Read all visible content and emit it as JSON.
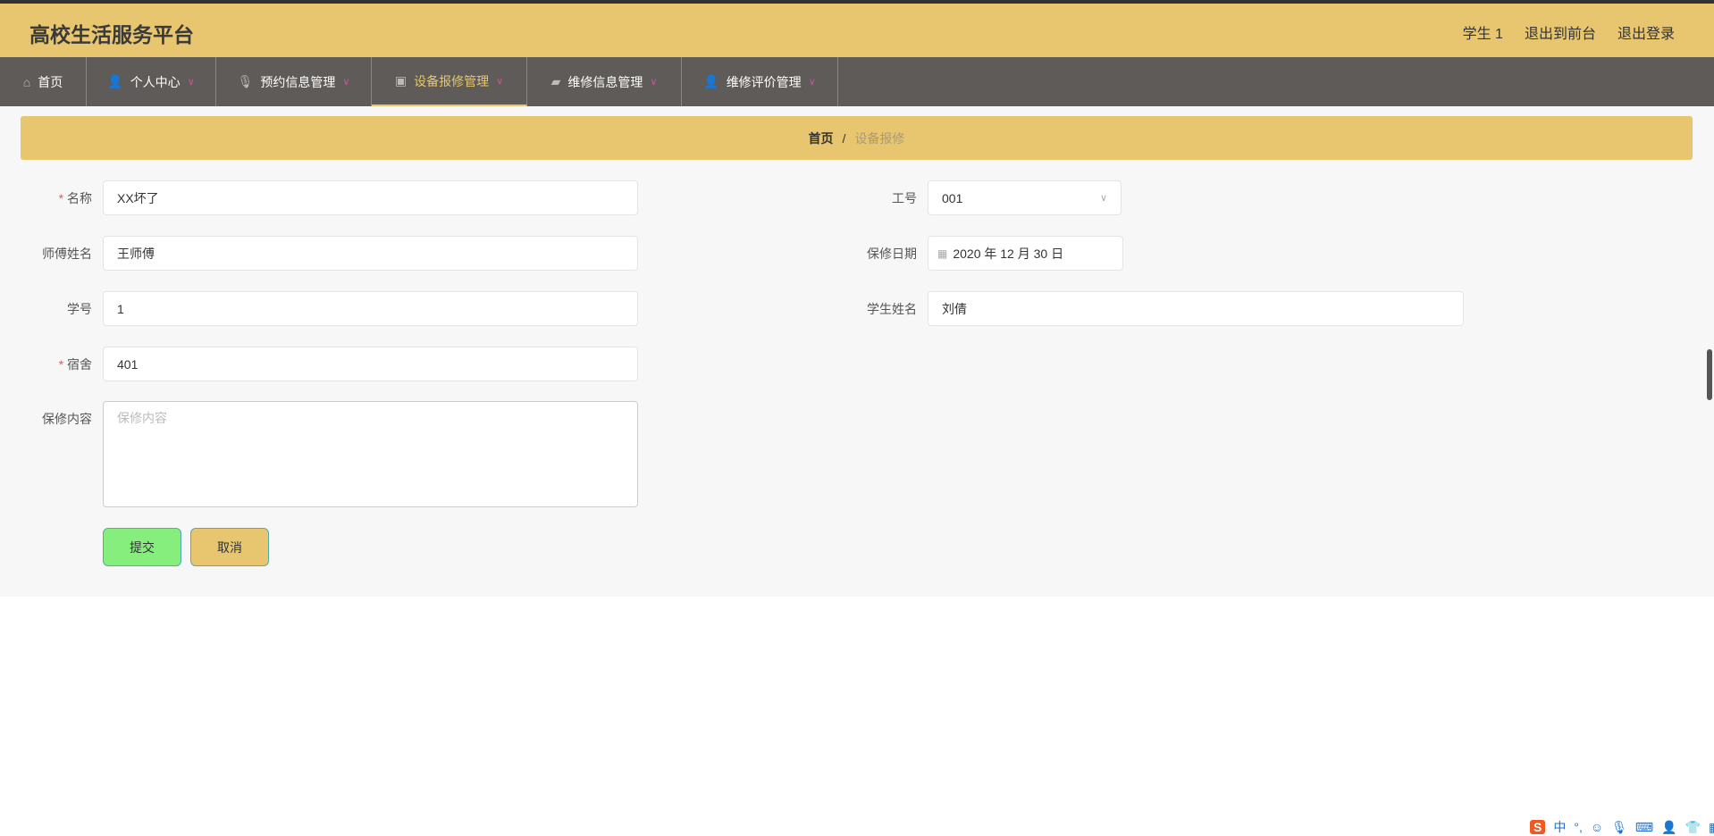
{
  "header": {
    "title": "高校生活服务平台",
    "links": [
      "学生 1",
      "退出到前台",
      "退出登录"
    ]
  },
  "nav": [
    {
      "label": "首页",
      "icon": "home-icon"
    },
    {
      "label": "个人中心",
      "icon": "user-icon"
    },
    {
      "label": "预约信息管理",
      "icon": "microphone-icon"
    },
    {
      "label": "设备报修管理",
      "icon": "clipboard-icon",
      "active": true
    },
    {
      "label": "维修信息管理",
      "icon": "wallet-icon"
    },
    {
      "label": "维修评价管理",
      "icon": "user-icon"
    }
  ],
  "breadcrumb": {
    "home": "首页",
    "sep": "/",
    "current": "设备报修"
  },
  "form": {
    "name": {
      "label": "名称",
      "value": "XX坏了"
    },
    "worker_id": {
      "label": "工号",
      "value": "001"
    },
    "master_name": {
      "label": "师傅姓名",
      "value": "王师傅"
    },
    "repair_date": {
      "label": "保修日期",
      "value": "2020 年 12 月 30 日"
    },
    "student_id": {
      "label": "学号",
      "value": "1"
    },
    "student_name": {
      "label": "学生姓名",
      "value": "刘倩"
    },
    "dorm": {
      "label": "宿舍",
      "value": "401"
    },
    "content": {
      "label": "保修内容",
      "placeholder": "保修内容"
    },
    "submit": "提交",
    "cancel": "取消",
    "required_mark": "*"
  },
  "ime": {
    "lang": "中",
    "punct": "°,"
  },
  "colors": {
    "accent": "#e7c66f",
    "nav": "#5f5b58",
    "submit": "#85ee7c"
  }
}
